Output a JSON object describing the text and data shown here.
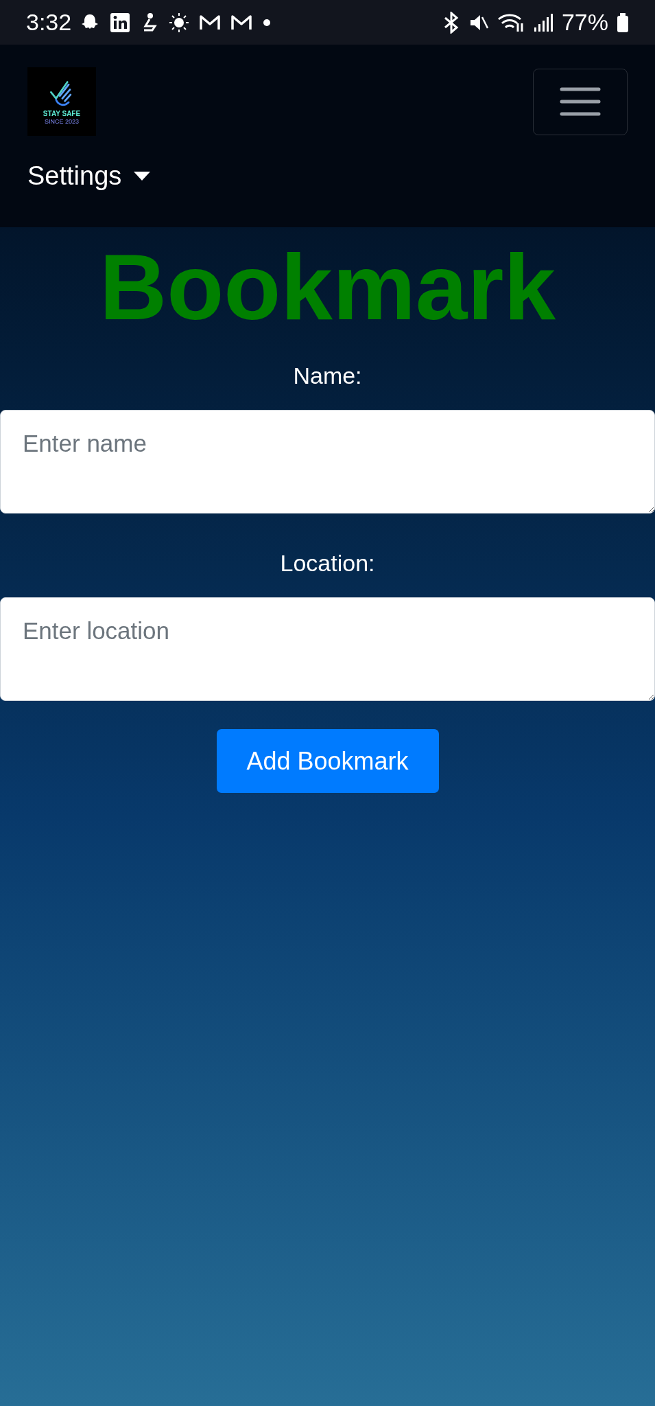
{
  "status_bar": {
    "time": "3:32",
    "battery": "77%"
  },
  "navbar": {
    "logo": {
      "line_1": "STAY SAFE",
      "line_2": "SINCE 2023"
    },
    "menu": {
      "label": "Settings",
      "expanded": false
    }
  },
  "title": "Bookmark",
  "form": {
    "fields": [
      {
        "label": "Name:",
        "placeholder": "Enter name"
      },
      {
        "label": "Location:",
        "placeholder": "Enter location"
      }
    ],
    "submit": "Add Bookmark"
  }
}
